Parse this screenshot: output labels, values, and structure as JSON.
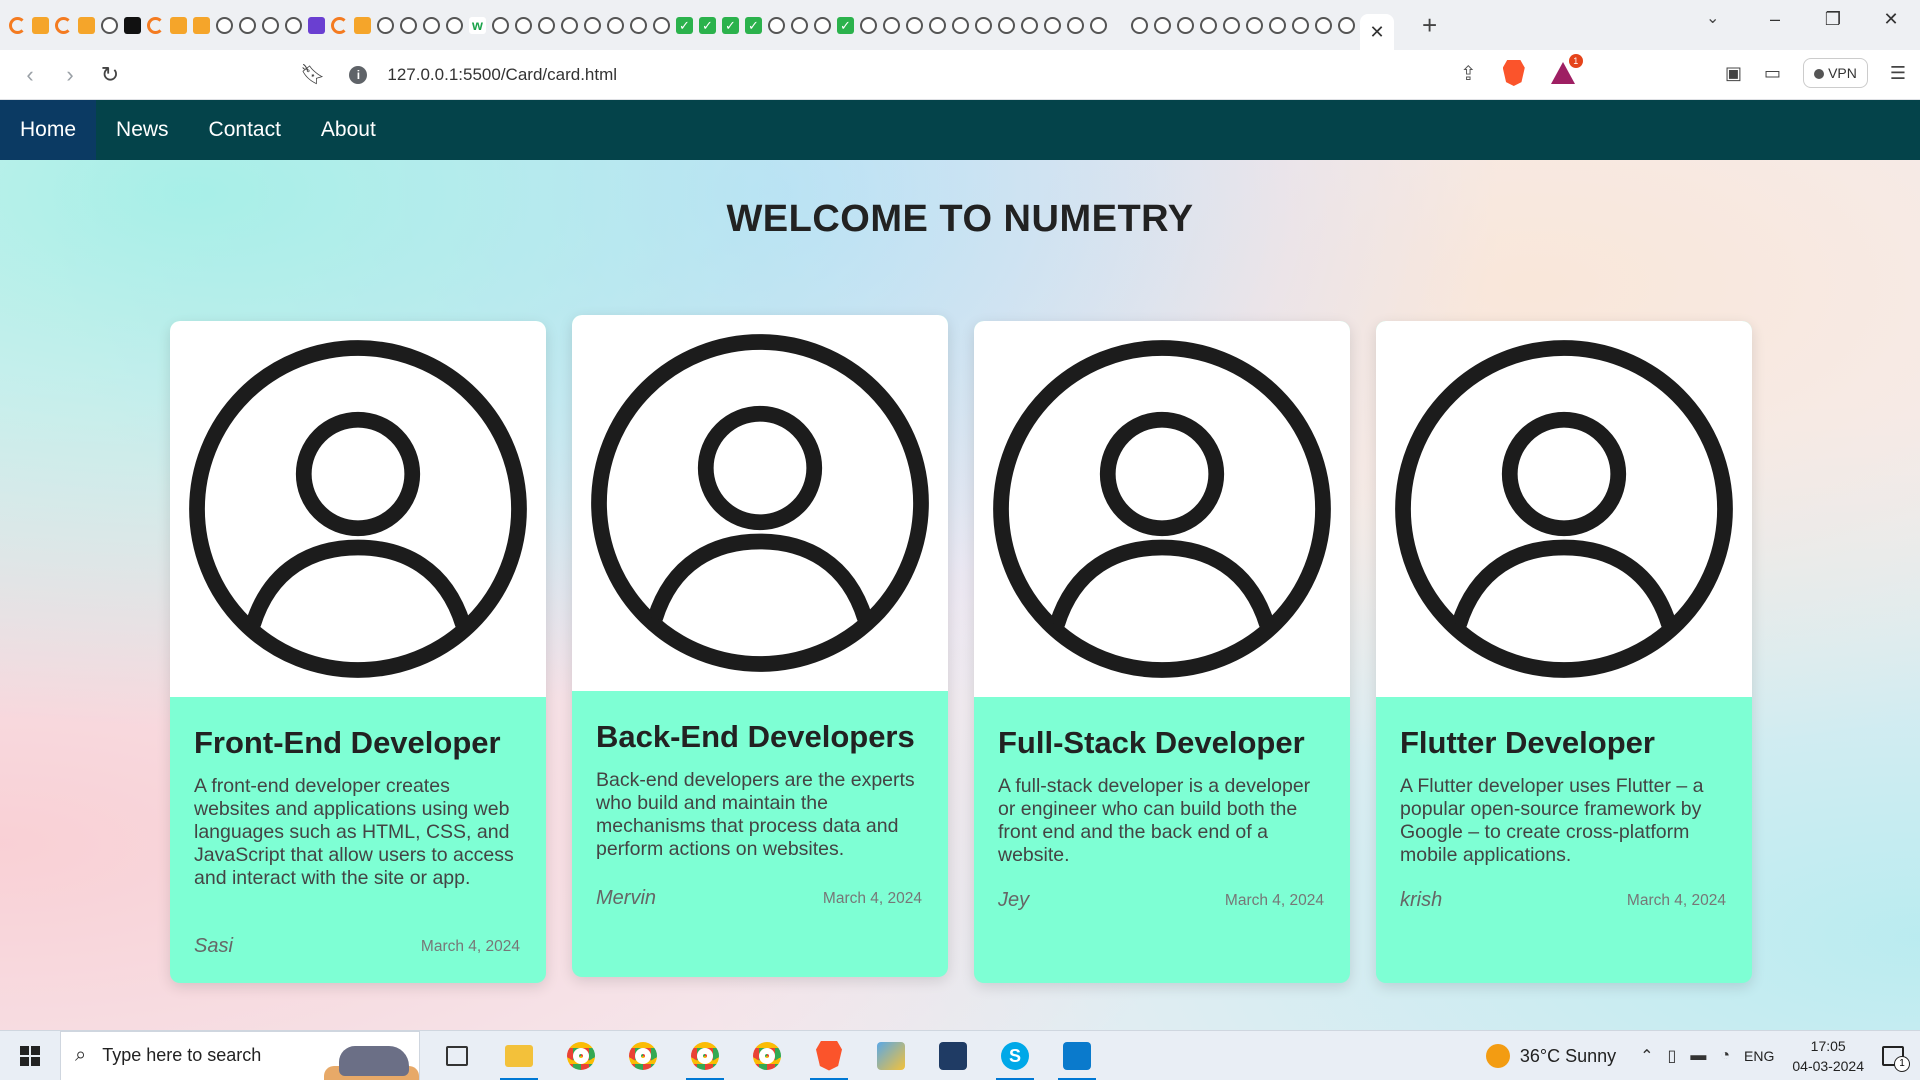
{
  "browser": {
    "url": "127.0.0.1:5500/Card/card.html",
    "vpn_label": "VPN",
    "notification_count": "1"
  },
  "nav": {
    "items": [
      "Home",
      "News",
      "Contact",
      "About"
    ],
    "active": "Home"
  },
  "page": {
    "title": "WELCOME TO NUMETRY"
  },
  "cards": [
    {
      "title": "Front-End Developer",
      "description": "A front-end developer creates websites and applications using web languages such as HTML, CSS, and JavaScript that allow users to access and interact with the site or app.",
      "author": "Sasi",
      "date": "March 4, 2024"
    },
    {
      "title": "Back-End Developers",
      "description": "Back-end developers are the experts who build and maintain the mechanisms that process data and perform actions on websites.",
      "author": "Mervin",
      "date": "March 4, 2024"
    },
    {
      "title": "Full-Stack Developer",
      "description": "A full-stack developer is a developer or engineer who can build both the front end and the back end of a website.",
      "author": "Jey",
      "date": "March 4, 2024"
    },
    {
      "title": "Flutter Developer",
      "description": "A Flutter developer uses Flutter – a popular open-source framework by Google – to create cross-platform mobile applications.",
      "author": "krish",
      "date": "March 4, 2024"
    }
  ],
  "taskbar": {
    "search_placeholder": "Type here to search",
    "weather": "36°C  Sunny",
    "language": "ENG",
    "time": "17:05",
    "date": "04-03-2024",
    "notification_count": "1"
  },
  "colors": {
    "nav_bg": "#04434a",
    "nav_active": "#0b3a63",
    "card_body": "#7effd4"
  }
}
